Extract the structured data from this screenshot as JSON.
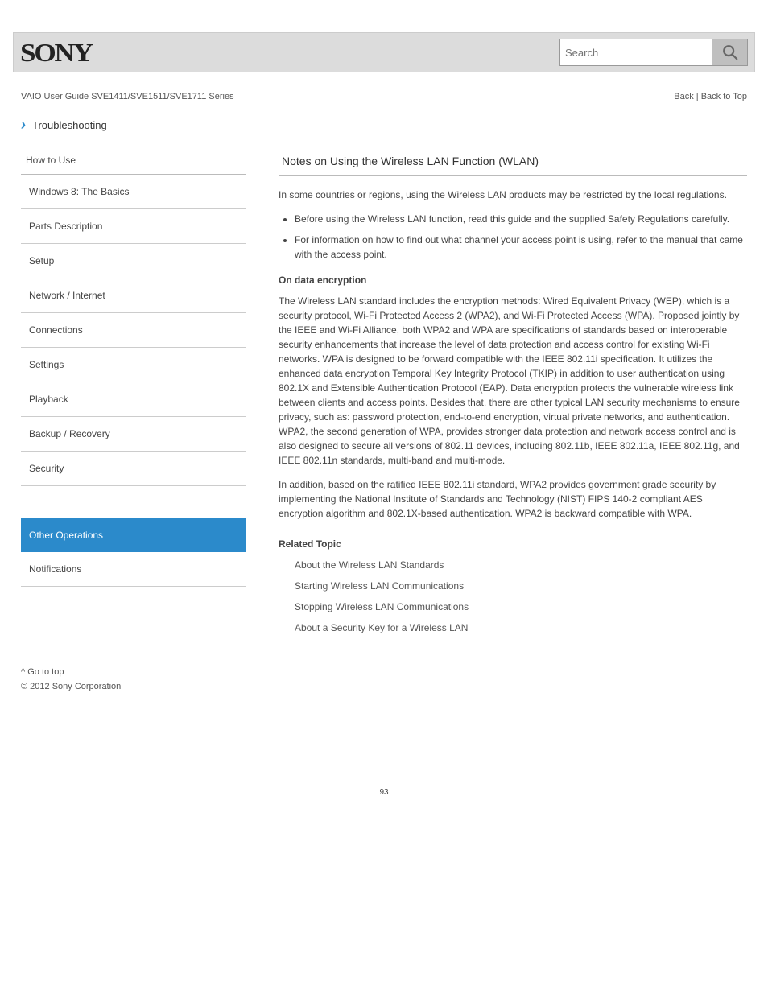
{
  "header": {
    "brand": "SONY",
    "search_placeholder": "Search"
  },
  "topline": {
    "left": "VAIO User Guide SVE1411/SVE1511/SVE1711 Series",
    "right_back": "Back",
    "right_sep": " | ",
    "right_top": "Back to Top"
  },
  "troubleshooting": {
    "label": "Troubleshooting"
  },
  "sidebar": {
    "heading": "How to Use",
    "items": [
      "Windows 8: The Basics",
      "Parts Description",
      "Setup",
      "Network / Internet",
      "Connections",
      "Settings",
      "Playback",
      "Backup / Recovery",
      "Security",
      "Other Operations",
      "Notifications"
    ]
  },
  "main": {
    "title": "Notes on Using the Wireless LAN Function (WLAN)",
    "body": {
      "intro": "In some countries or regions, using the Wireless LAN products may be restricted by the local regulations.",
      "points": [
        "Before using the Wireless LAN function, read this guide and the supplied Safety Regulations carefully.",
        "For information on how to find out what channel your access point is using, refer to the manual that came with the access point."
      ],
      "enc_heading": "On data encryption",
      "enc_p1": "The Wireless LAN standard includes the encryption methods: Wired Equivalent Privacy (WEP), which is a security protocol, Wi-Fi Protected Access 2 (WPA2), and Wi-Fi Protected Access (WPA). Proposed jointly by the IEEE and Wi-Fi Alliance, both WPA2 and WPA are specifications of standards based on interoperable security enhancements that increase the level of data protection and access control for existing Wi-Fi networks. WPA is designed to be forward compatible with the IEEE 802.11i specification. It utilizes the enhanced data encryption Temporal Key Integrity Protocol (TKIP) in addition to user authentication using 802.1X and Extensible Authentication Protocol (EAP). Data encryption protects the vulnerable wireless link between clients and access points. Besides that, there are other typical LAN security mechanisms to ensure privacy, such as: password protection, end-to-end encryption, virtual private networks, and authentication. WPA2, the second generation of WPA, provides stronger data protection and network access control and is also designed to secure all versions of 802.11 devices, including 802.11b, IEEE 802.11a, IEEE 802.11g, and IEEE 802.11n standards, multi-band and multi-mode.",
      "enc_p2": "In addition, based on the ratified IEEE 802.11i standard, WPA2 provides government grade security by implementing the National Institute of Standards and Technology (NIST) FIPS 140-2 compliant AES encryption algorithm and 802.1X-based authentication. WPA2 is backward compatible with WPA.",
      "related_heading": "Related Topic",
      "related": [
        "About the Wireless LAN Standards",
        "Starting Wireless LAN Communications",
        "Stopping Wireless LAN Communications",
        "About a Security Key for a Wireless LAN"
      ]
    }
  },
  "footer": {
    "gototop": "^ Go to top",
    "copyright": "© 2012 Sony Corporation"
  },
  "pagenum": "93"
}
